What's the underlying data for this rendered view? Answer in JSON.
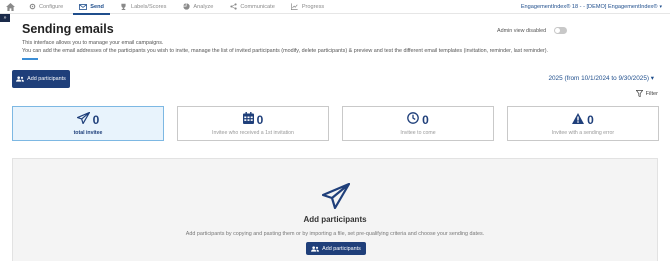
{
  "nav": {
    "tabs": [
      {
        "label": "Configure",
        "icon": "gear-icon"
      },
      {
        "label": "Send",
        "icon": "mail-icon"
      },
      {
        "label": "Labels/Scores",
        "icon": "trophy-icon"
      },
      {
        "label": "Analyze",
        "icon": "chart-pie-icon"
      },
      {
        "label": "Communicate",
        "icon": "share-icon"
      },
      {
        "label": "Progress",
        "icon": "line-chart-icon"
      }
    ],
    "active_tab": "Send",
    "org": "EngagementIndex® 18 - - [DEMO] EngagementIndex®"
  },
  "header": {
    "title": "Sending emails",
    "admin_view_label": "Admin view disabled",
    "admin_view_enabled": false,
    "description_1": "This interface allows you to manage your email campaigns.",
    "description_2": "You can add the email addresses of the participants you wish to invite, manage the list of invited participants (modify, delete participants) & preview and test the different email templates (invitation, reminder, last reminder)."
  },
  "toolbar": {
    "add_participants_label": "Add participants",
    "period": "2025 (from 10/1/2024 to 9/30/2025)",
    "filter_label": "Filter"
  },
  "stats": [
    {
      "value": "0",
      "label": "total invitee",
      "icon": "paper-plane-icon"
    },
    {
      "value": "0",
      "label": "Invitee who received a 1st invitation",
      "icon": "calendar-icon"
    },
    {
      "value": "0",
      "label": "Invitee to come",
      "icon": "clock-icon"
    },
    {
      "value": "0",
      "label": "Invitee with a sending error",
      "icon": "warning-icon"
    }
  ],
  "empty_state": {
    "title": "Add participants",
    "subtitle": "Add participants by copying and pasting them or by importing a file, set pre-qualifying criteria and choose your sending dates.",
    "button_label": "Add participants"
  },
  "colors": {
    "primary": "#1f3f7a",
    "link": "#1f4e8c",
    "accent": "#3b8ed6"
  }
}
